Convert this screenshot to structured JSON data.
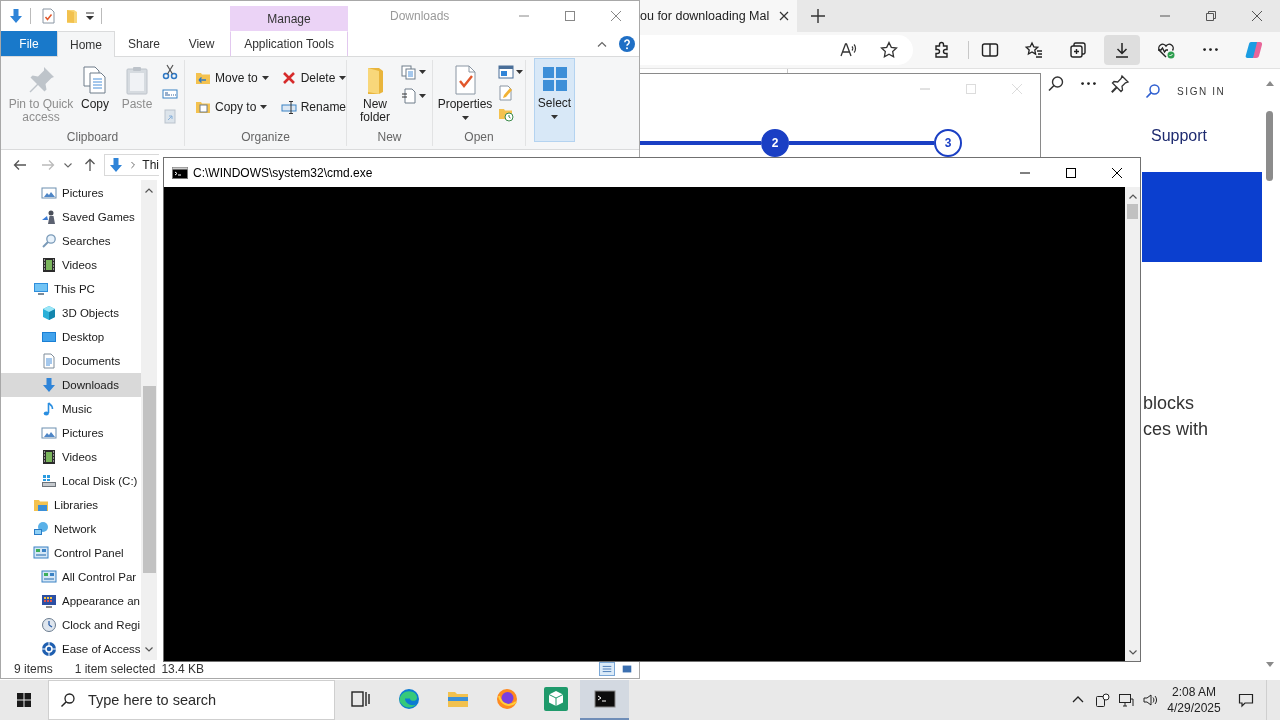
{
  "explorer": {
    "contextual_group": "Manage",
    "title": "Downloads",
    "file_tab": "File",
    "tabs": [
      {
        "label": "Home",
        "kind": "standard",
        "selected": true
      },
      {
        "label": "Share",
        "kind": "standard",
        "selected": false
      },
      {
        "label": "View",
        "kind": "standard",
        "selected": false
      },
      {
        "label": "Application Tools",
        "kind": "contextual",
        "selected": false
      }
    ],
    "ribbon": {
      "clipboard": {
        "label": "Clipboard",
        "commands": [
          {
            "label": "Pin to Quick access",
            "disabled": true
          },
          {
            "label": "Copy",
            "disabled": false
          },
          {
            "label": "Paste",
            "disabled": true
          }
        ]
      },
      "organize": {
        "label": "Organize",
        "commands": [
          {
            "label": "Move to",
            "dropdown": true
          },
          {
            "label": "Copy to",
            "dropdown": true
          },
          {
            "label": "Delete",
            "dropdown": true
          },
          {
            "label": "Rename",
            "dropdown": false
          }
        ]
      },
      "new": {
        "label": "New",
        "command": "New folder"
      },
      "open": {
        "label": "Open",
        "command": "Properties"
      },
      "select": {
        "command": "Select",
        "highlighted": true
      }
    },
    "address": "Thi",
    "nav_tree": [
      {
        "children": [
          {
            "label": "Pictures",
            "selected": false
          },
          {
            "label": "Saved Games",
            "selected": false
          },
          {
            "label": "Searches",
            "selected": false
          },
          {
            "label": "Videos",
            "selected": false
          }
        ]
      },
      {
        "label": "This PC",
        "selected": false,
        "children": [
          {
            "label": "3D Objects",
            "selected": false
          },
          {
            "label": "Desktop",
            "selected": false
          },
          {
            "label": "Documents",
            "selected": false
          },
          {
            "label": "Downloads",
            "selected": true
          },
          {
            "label": "Music",
            "selected": false
          },
          {
            "label": "Pictures",
            "selected": false
          },
          {
            "label": "Videos",
            "selected": false
          },
          {
            "label": "Local Disk (C:)",
            "selected": false
          }
        ]
      },
      {
        "label": "Libraries",
        "selected": false
      },
      {
        "label": "Network",
        "selected": false
      },
      {
        "label": "Control Panel",
        "selected": false,
        "children": [
          {
            "label": "All Control Par",
            "selected": false
          },
          {
            "label": "Appearance an",
            "selected": false
          },
          {
            "label": "Clock and Regi",
            "selected": false
          },
          {
            "label": "Ease of Access",
            "selected": false
          }
        ]
      }
    ],
    "status": {
      "items": "9 items",
      "selection": "1 item selected",
      "size": "13.4 KB"
    },
    "views": [
      {
        "selected": true
      },
      {
        "selected": false
      }
    ]
  },
  "browser": {
    "tabs": [
      {
        "title": "ou for downloading Mal",
        "selected": true
      }
    ],
    "toolbar": [
      {
        "selected": false
      },
      {
        "selected": false
      },
      {
        "selected": false
      },
      {
        "selected": false
      },
      {
        "selected": true
      },
      {
        "selected": false
      },
      {
        "selected": false
      },
      {
        "selected": false
      }
    ],
    "installer": {
      "steps": [
        {
          "number": "2",
          "current": true
        },
        {
          "number": "3",
          "current": false
        }
      ]
    },
    "page": {
      "sign_in": "SIGN IN",
      "nav_link": "Support",
      "text_lines": [
        "blocks",
        "ces with"
      ]
    }
  },
  "console": {
    "title": "C:\\WINDOWS\\system32\\cmd.exe"
  },
  "taskbar": {
    "search": {
      "placeholder": "Type here to search"
    },
    "buttons": [
      {
        "selected": false
      },
      {
        "selected": false
      },
      {
        "selected": false
      },
      {
        "selected": false
      },
      {
        "selected": false
      },
      {
        "selected": true
      }
    ],
    "time": "2:08 AM",
    "date": "4/29/2025"
  }
}
